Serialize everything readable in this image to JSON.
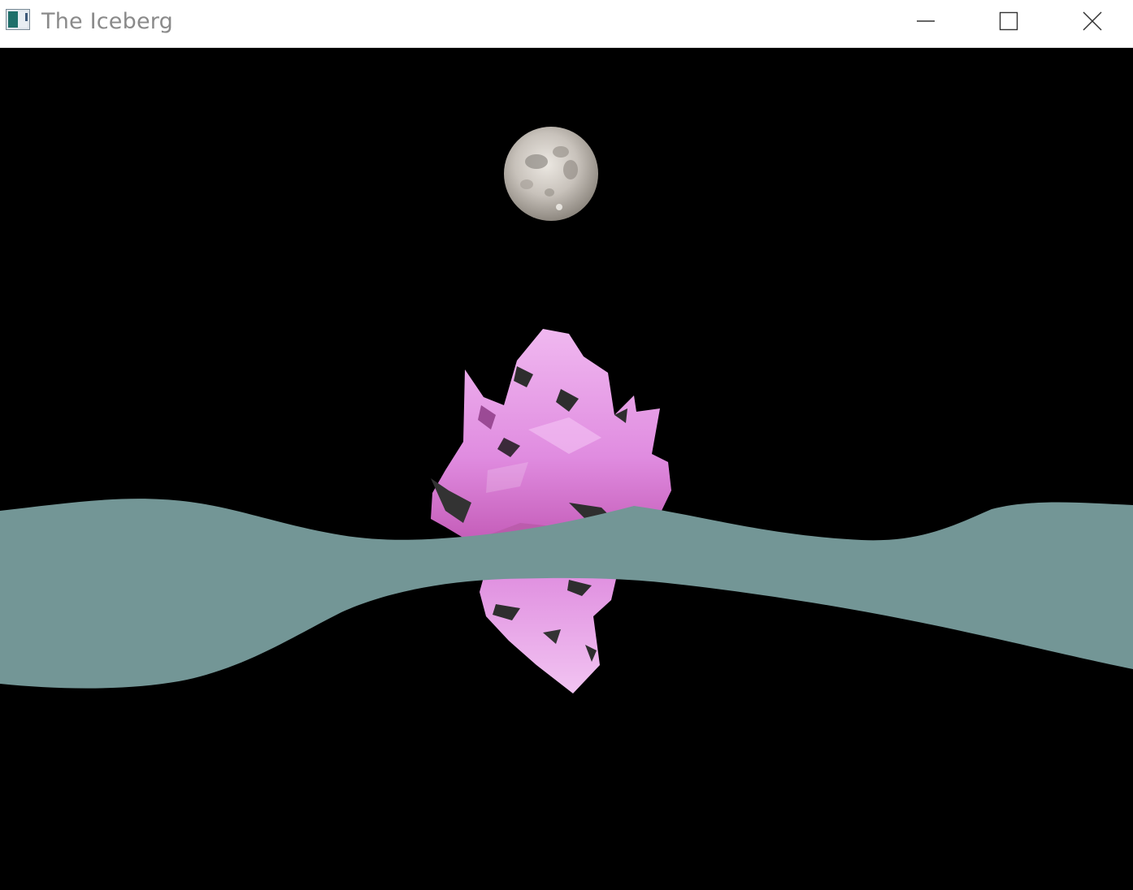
{
  "window": {
    "title": "The Iceberg",
    "icon": "app-window-icon",
    "controls": {
      "minimize_icon": "minimize-icon",
      "maximize_icon": "maximize-icon",
      "close_icon": "close-icon"
    }
  },
  "scene": {
    "background_color": "#000000",
    "water_color": "#739696",
    "iceberg_color": "#e08ce0",
    "moon_color": "#c8c2bb"
  }
}
